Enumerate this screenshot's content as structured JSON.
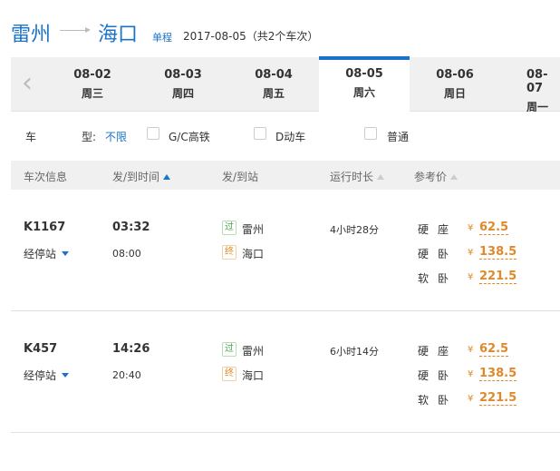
{
  "header": {
    "from_city": "雷州",
    "to_city": "海口",
    "trip_type": "单程",
    "date_summary": "2017-08-05（共2个车次）"
  },
  "dates": [
    {
      "date": "08-02",
      "weekday": "周三"
    },
    {
      "date": "08-03",
      "weekday": "周四"
    },
    {
      "date": "08-04",
      "weekday": "周五"
    },
    {
      "date": "08-05",
      "weekday": "周六"
    },
    {
      "date": "08-06",
      "weekday": "周日"
    },
    {
      "date": "08-07",
      "weekday": "周一"
    }
  ],
  "active_date_index": 3,
  "filters": {
    "label_che": "车",
    "label_xing": "型:",
    "any": "不限",
    "options": [
      "G/C高铁",
      "D动车",
      "普通"
    ]
  },
  "table_header": {
    "train_info": "车次信息",
    "dep_arr_time": "发/到时间",
    "dep_arr_station": "发/到站",
    "duration": "运行时长",
    "price": "参考价"
  },
  "trains": [
    {
      "number": "K1167",
      "stops_label": "经停站",
      "dep_time": "03:32",
      "arr_time": "08:00",
      "dep_badge": "过",
      "dep_station": "雷州",
      "arr_badge": "终",
      "arr_station": "海口",
      "duration": "4小时28分",
      "seats": [
        {
          "type": "硬座",
          "yen": "¥",
          "price": "62.5"
        },
        {
          "type": "硬卧",
          "yen": "¥",
          "price": "138.5"
        },
        {
          "type": "软卧",
          "yen": "¥",
          "price": "221.5"
        }
      ]
    },
    {
      "number": "K457",
      "stops_label": "经停站",
      "dep_time": "14:26",
      "arr_time": "20:40",
      "dep_badge": "过",
      "dep_station": "雷州",
      "arr_badge": "终",
      "arr_station": "海口",
      "duration": "6小时14分",
      "seats": [
        {
          "type": "硬座",
          "yen": "¥",
          "price": "62.5"
        },
        {
          "type": "硬卧",
          "yen": "¥",
          "price": "138.5"
        },
        {
          "type": "软卧",
          "yen": "¥",
          "price": "221.5"
        }
      ]
    }
  ]
}
